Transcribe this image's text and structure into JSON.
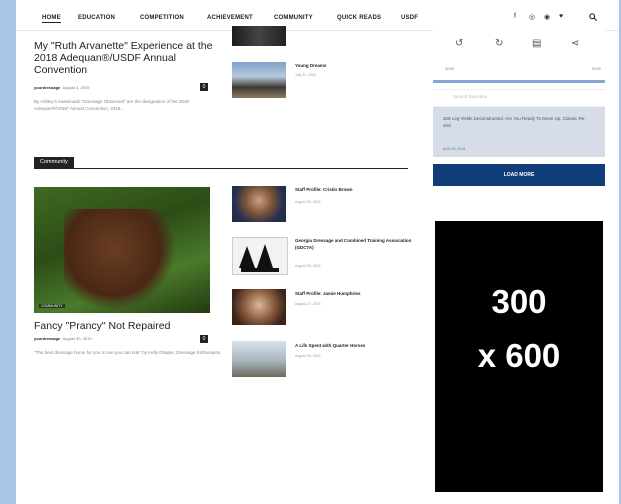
{
  "nav": {
    "items": [
      "HOME",
      "EDUCATION",
      "COMPETITION",
      "ACHIEVEMENT",
      "COMMUNITY",
      "QUICK READS",
      "USDF"
    ],
    "social": [
      "f",
      "◎",
      "◉",
      "♥"
    ]
  },
  "article_top": {
    "title": "My \"Ruth Arvanette\" Experience at the 2018 Adequan®/USDF Annual Convention",
    "author": "yourdressage",
    "date": "August 3, 2019",
    "comments": "0",
    "excerpt": "By Ashley's Asaminado \"Dressage Obsessed\" are the designation of the 2018 Adequan®/USDF Annual Convention, 2018..."
  },
  "side_top": {
    "title": "Young Dreams",
    "date": "July 31, 2019"
  },
  "section": {
    "label": "Community"
  },
  "featured": {
    "tag": "COMMUNITY",
    "title": "Fancy \"Prancy\" Not Repaired",
    "author": "yourdressage",
    "date": "August 30, 2019",
    "comments": "0",
    "excerpt": "\"The best dressage horse for you is one you can ride\" by Kelly Dhaper, Dressage Enthusiasts."
  },
  "list": [
    {
      "title": "Staff Profile: Cristin Brown",
      "date": "August 30, 2019"
    },
    {
      "title": "Georgia Dressage and Combined Training Association (GDCTA)",
      "date": "August 28, 2019"
    },
    {
      "title": "Staff Profile: Jamie Humphries",
      "date": "August 27, 2019"
    },
    {
      "title": "A Life Spent with Quarter Horses",
      "date": "August 26, 2019"
    }
  ],
  "podcast": {
    "elapsed": "00:00",
    "total": "00:00",
    "search_placeholder": "Search Episodes",
    "episode_title": "328 Leg Yields Deconstructed, Are You Ready To Move Up, Classic Re-visit",
    "episode_date": "AUG 28, 2019",
    "load_more": "LOAD MORE"
  },
  "ad": {
    "line1": "300",
    "line2": "x 600"
  }
}
